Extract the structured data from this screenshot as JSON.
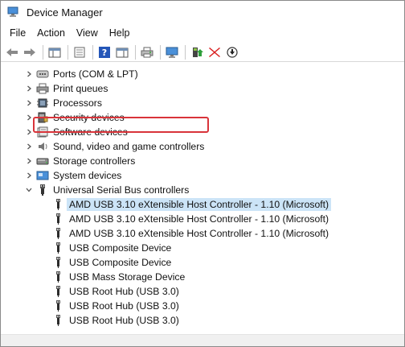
{
  "window": {
    "title": "Device Manager"
  },
  "menu": [
    "File",
    "Action",
    "View",
    "Help"
  ],
  "toolbar": {
    "icons": [
      "back-arrow-icon",
      "forward-arrow-icon",
      "show-hide-console-tree-icon",
      "properties-icon",
      "help-icon",
      "action-pane-icon",
      "print-icon",
      "scan-hardware-icon",
      "update-driver-icon",
      "uninstall-icon",
      "disable-device-icon"
    ]
  },
  "tree": {
    "collapsed_categories": [
      {
        "label": "Ports (COM & LPT)",
        "icon": "port-icon"
      },
      {
        "label": "Print queues",
        "icon": "printer-icon"
      },
      {
        "label": "Processors",
        "icon": "processor-icon"
      },
      {
        "label": "Security devices",
        "icon": "security-icon"
      },
      {
        "label": "Software devices",
        "icon": "software-icon"
      },
      {
        "label": "Sound, video and game controllers",
        "icon": "speaker-icon"
      },
      {
        "label": "Storage controllers",
        "icon": "storage-icon"
      },
      {
        "label": "System devices",
        "icon": "system-icon"
      }
    ],
    "expanded_category": {
      "label": "Universal Serial Bus controllers",
      "icon": "usb-icon"
    },
    "devices": [
      {
        "label": "AMD USB 3.10 eXtensible Host Controller - 1.10 (Microsoft)",
        "selected": true
      },
      {
        "label": "AMD USB 3.10 eXtensible Host Controller - 1.10 (Microsoft)",
        "selected": false
      },
      {
        "label": "AMD USB 3.10 eXtensible Host Controller - 1.10 (Microsoft)",
        "selected": false
      },
      {
        "label": "USB Composite Device",
        "selected": false
      },
      {
        "label": "USB Composite Device",
        "selected": false
      },
      {
        "label": "USB Mass Storage Device",
        "selected": false
      },
      {
        "label": "USB Root Hub (USB 3.0)",
        "selected": false
      },
      {
        "label": "USB Root Hub (USB 3.0)",
        "selected": false
      },
      {
        "label": "USB Root Hub (USB 3.0)",
        "selected": false
      }
    ]
  },
  "colors": {
    "selection": "#cce4f7",
    "highlight": "#d9343a",
    "accent": "#1e5fb4"
  }
}
